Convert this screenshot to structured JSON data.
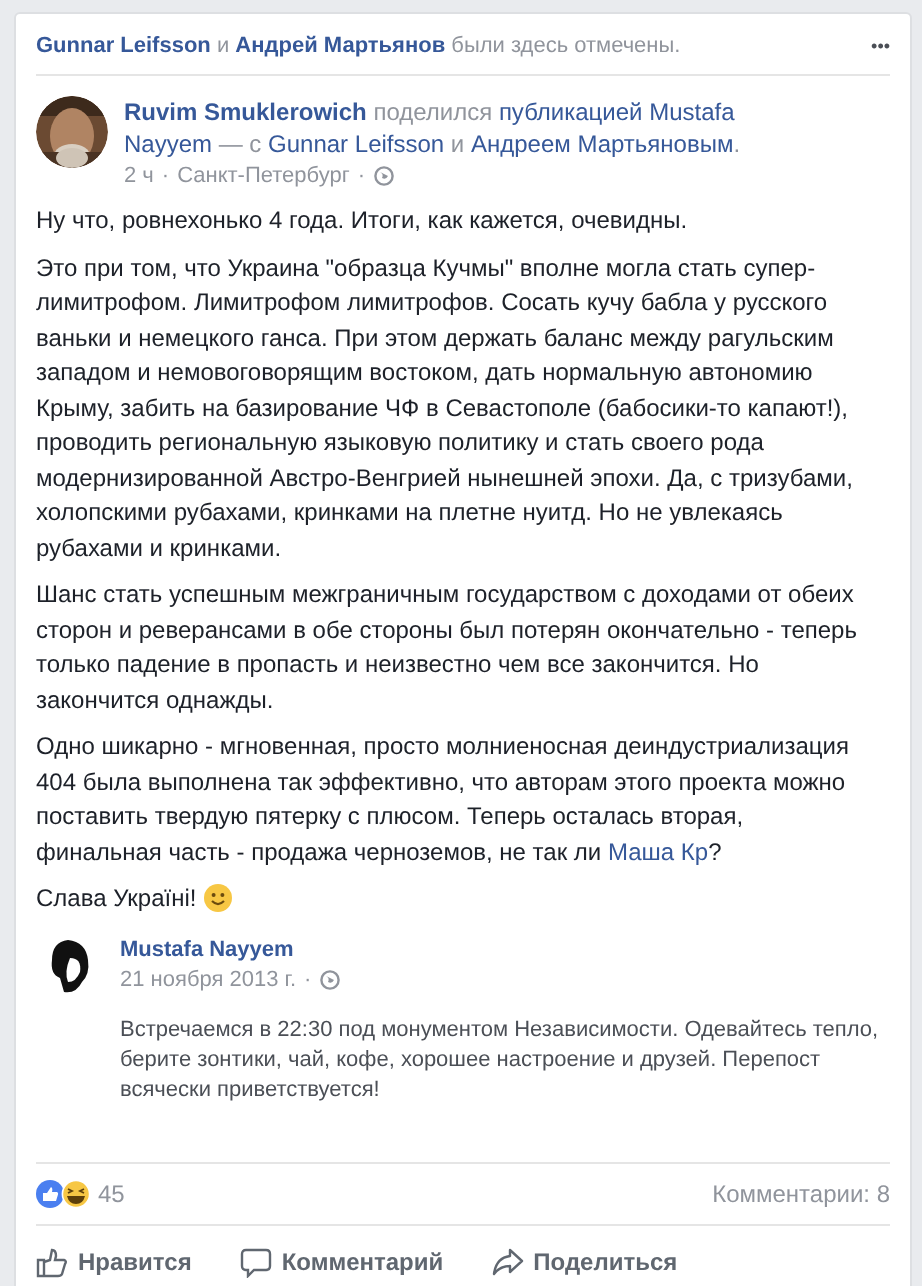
{
  "tagged_header": {
    "parts": [
      {
        "text": "Gunnar Leifsson",
        "kind": "bold-link"
      },
      {
        "text": " и ",
        "kind": "text"
      },
      {
        "text": "Андрей Мартьянов",
        "kind": "bold-link"
      },
      {
        "text": " были здесь отмечены.",
        "kind": "text"
      }
    ],
    "menu": "•••"
  },
  "post": {
    "author_line": [
      {
        "text": "Ruvim Smuklerowich",
        "kind": "bold-link"
      },
      {
        "text": " поделился ",
        "kind": "text"
      },
      {
        "text": "публикацией Mustafa",
        "kind": "link"
      },
      {
        "text": "Nayyem",
        "kind": "link"
      },
      {
        "text": " — с ",
        "kind": "text"
      },
      {
        "text": "Gunnar Leifsson",
        "kind": "link"
      },
      {
        "text": " и ",
        "kind": "text"
      },
      {
        "text": "Андреем Мартьяновым",
        "kind": "link"
      },
      {
        "text": ".",
        "kind": "text"
      }
    ],
    "time": "2 ч",
    "separator": "·",
    "location": "Санкт-Петербург",
    "separator_2": "·",
    "paragraphs": [
      [
        {
          "text": "Ну что, ровнехонько 4 года. Итоги, как кажется, очевидны.",
          "kind": "text"
        }
      ],
      [
        {
          "text": "Это при том, что Украина \"образца Кучмы\" вполне могла стать супер-лимитрофом. Лимитрофом лимитрофов. Сосать кучу бабла у русского ваньки и немецкого ганса. При этом держать баланс между рагульским западом и немовоговорящим востоком, дать нормальную автономию Крыму, забить на базирование ЧФ в Севастополе (бабосики-то капают!), проводить региональную языковую политику и стать своего рода модернизированной Австро-Венгрией нынешней эпохи. Да, с тризубами, холопскими рубахами, кринками на плетне нуитд. Но не увлекаясь рубахами и кринками.",
          "kind": "text"
        }
      ],
      [
        {
          "text": "Шанс стать успешным межграничным государством с доходами от обеих сторон и реверансами в обе стороны был потерян окончательно - теперь только падение в пропасть и неизвестно чем все закончится. Но закончится однажды.",
          "kind": "text"
        }
      ],
      [
        {
          "text": "Одно шикарно - мгновенная, просто молниеносная деиндустриализация 404 была выполнена так эффективно, что авторам этого проекта можно поставить твердую пятерку с плюсом. Теперь осталась вторая, финальная часть - продажа черноземов, не так ли ",
          "kind": "text"
        },
        {
          "text": "Маша Кр",
          "kind": "link"
        },
        {
          "text": "?",
          "kind": "text"
        }
      ],
      [
        {
          "text": "Слава Україні! ",
          "kind": "text"
        },
        {
          "kind": "smiley"
        }
      ]
    ],
    "shared": {
      "author": "Mustafa Nayyem",
      "date": "21 ноября 2013 г.",
      "separator": "·",
      "text": "Встречаемся в 22:30 под монументом Независимости. Одевайтесь тепло, берите зонтики, чай, кофе, хорошее настроение и друзей. Перепост всячески приветствуется!"
    },
    "reactions_count": "45",
    "comments_count": "Комментарии: 8",
    "actions": [
      {
        "label": "Нравится",
        "kind": "like"
      },
      {
        "label": "Комментарий",
        "kind": "comment"
      },
      {
        "label": "Поделиться",
        "kind": "share"
      }
    ]
  }
}
